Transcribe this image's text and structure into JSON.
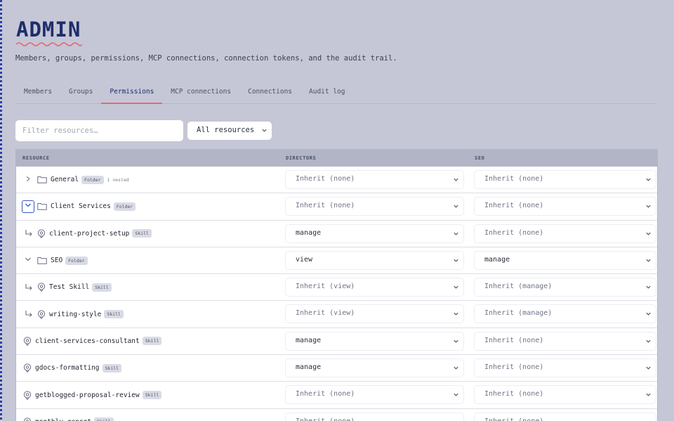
{
  "page": {
    "title": "ADMIN",
    "subtitle": "Members, groups, permissions, MCP connections, connection tokens, and the audit trail."
  },
  "tabs": [
    {
      "label": "Members"
    },
    {
      "label": "Groups"
    },
    {
      "label": "Permissions",
      "active": true
    },
    {
      "label": "MCP connections"
    },
    {
      "label": "Connections"
    },
    {
      "label": "Audit log"
    }
  ],
  "filter": {
    "placeholder": "Filter resources…",
    "value": ""
  },
  "resource_select": {
    "value": "All resources"
  },
  "table": {
    "columns": {
      "resource": "RESOURCE",
      "directors": "DIRECTORS",
      "seo": "SEO"
    },
    "rows": [
      {
        "name": "General",
        "badge": "Folder",
        "note": "1 nested",
        "toggle": "collapsed",
        "icon": "folder-icon",
        "directors": "Inherit (none)",
        "seo": "Inherit (none)"
      },
      {
        "name": "Client Services",
        "badge": "Folder",
        "note": "",
        "toggle": "expanded",
        "icon": "folder-icon",
        "directors": "Inherit (none)",
        "seo": "Inherit (none)"
      },
      {
        "name": "client-project-setup",
        "badge": "Skill",
        "note": "",
        "toggle": "child",
        "icon": "skill-icon",
        "directors": "manage",
        "seo": "Inherit (none)"
      },
      {
        "name": "SEO",
        "badge": "Folder",
        "note": "",
        "toggle": "expanded",
        "icon": "folder-icon",
        "directors": "view",
        "seo": "manage"
      },
      {
        "name": "Test Skill",
        "badge": "Skill",
        "note": "",
        "toggle": "child",
        "icon": "skill-icon",
        "directors": "Inherit (view)",
        "seo": "Inherit (manage)"
      },
      {
        "name": "writing-style",
        "badge": "Skill",
        "note": "",
        "toggle": "child",
        "icon": "skill-icon",
        "directors": "Inherit (view)",
        "seo": "Inherit (manage)"
      },
      {
        "name": "client-services-consultant",
        "badge": "Skill",
        "note": "",
        "toggle": "none",
        "icon": "skill-icon",
        "directors": "manage",
        "seo": "Inherit (none)"
      },
      {
        "name": "gdocs-formatting",
        "badge": "Skill",
        "note": "",
        "toggle": "none",
        "icon": "skill-icon",
        "directors": "manage",
        "seo": "Inherit (none)"
      },
      {
        "name": "getblogged-proposal-review",
        "badge": "Skill",
        "note": "",
        "toggle": "none",
        "icon": "skill-icon",
        "directors": "Inherit (none)",
        "seo": "Inherit (none)"
      },
      {
        "name": "monthly-report",
        "badge": "Skill",
        "note": "",
        "toggle": "none",
        "icon": "skill-icon",
        "directors": "Inherit (none)",
        "seo": "Inherit (none)"
      }
    ]
  },
  "colors": {
    "accent": "#e8677a",
    "title": "#1e2d6b",
    "background": "#c5c7d6"
  }
}
